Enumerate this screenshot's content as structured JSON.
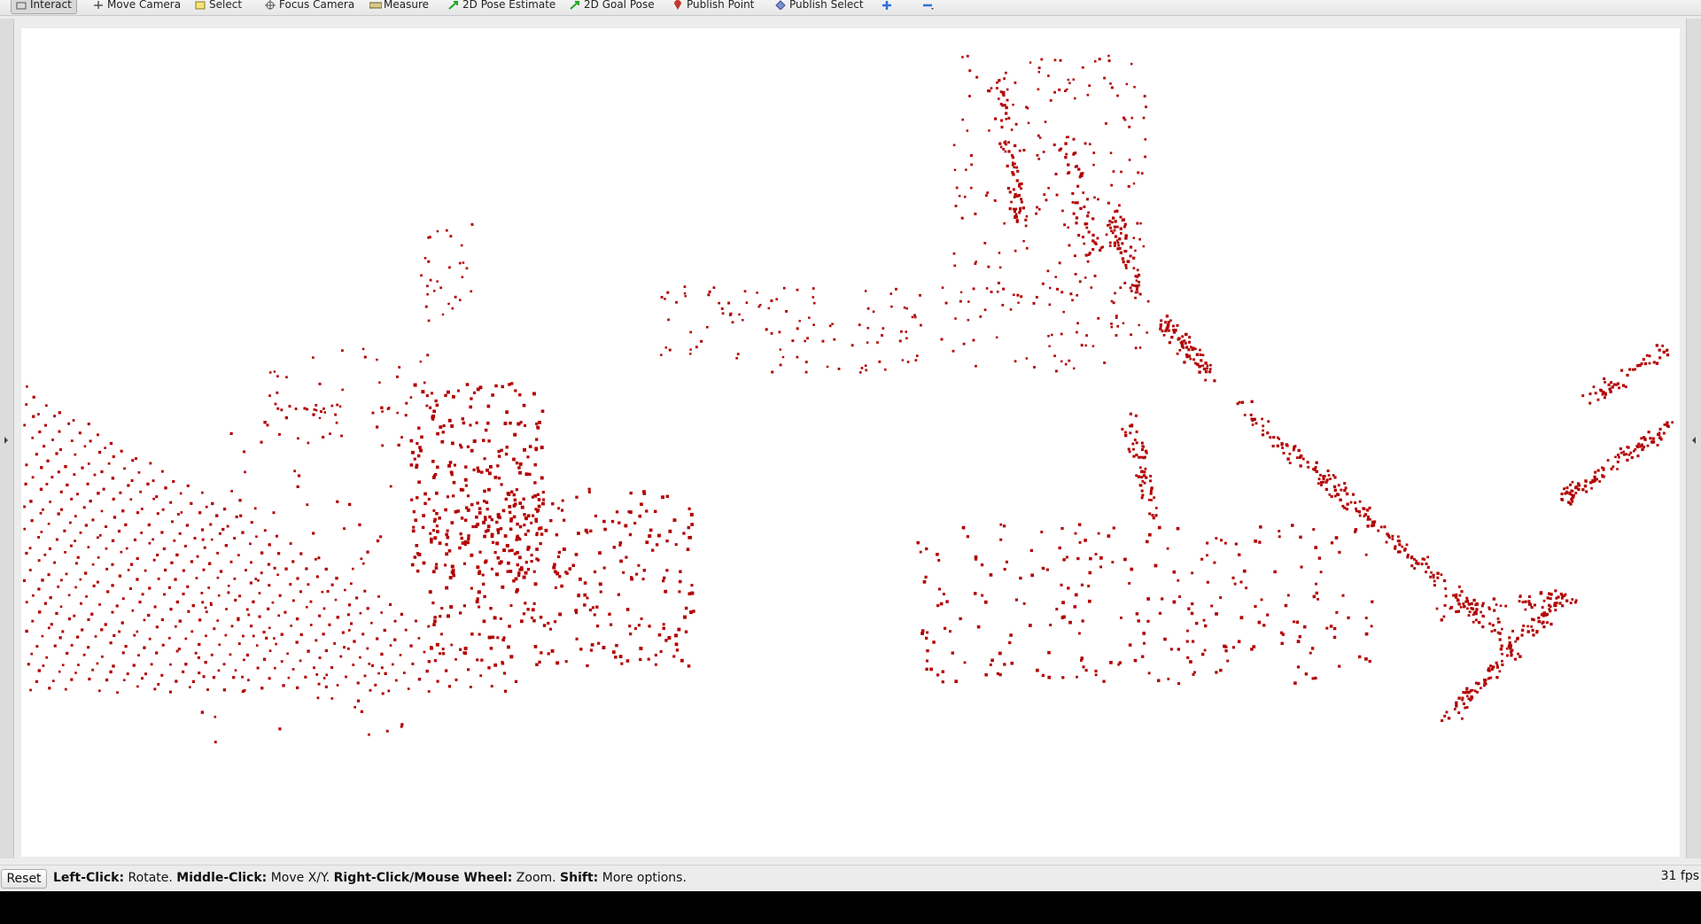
{
  "toolbar": {
    "tools": [
      {
        "id": "interact",
        "label": "Interact",
        "icon": "cursor-icon",
        "active": true
      },
      {
        "id": "move-camera",
        "label": "Move Camera",
        "icon": "move-camera-icon"
      },
      {
        "id": "select",
        "label": "Select",
        "icon": "select-icon"
      },
      {
        "id": "focus-camera",
        "label": "Focus Camera",
        "icon": "focus-camera-icon"
      },
      {
        "id": "measure",
        "label": "Measure",
        "icon": "measure-icon"
      },
      {
        "id": "pose-estimate",
        "label": "2D Pose Estimate",
        "icon": "green-arrow-icon"
      },
      {
        "id": "goal-pose",
        "label": "2D Goal Pose",
        "icon": "green-arrow-icon"
      },
      {
        "id": "publish-point",
        "label": "Publish Point",
        "icon": "map-pin-icon"
      },
      {
        "id": "publish-select",
        "label": "Publish Select",
        "icon": "select-box-icon"
      }
    ],
    "add_icon": "plus-icon",
    "remove_icon": "minus-icon"
  },
  "viewport": {
    "background": "#ffffff",
    "point_color": "#b30000"
  },
  "statusbar": {
    "reset_label": "Reset",
    "help": {
      "left_click_key": "Left-Click:",
      "left_click_action": "Rotate.",
      "middle_click_key": "Middle-Click:",
      "middle_click_action": "Move X/Y.",
      "right_click_key": "Right-Click/Mouse Wheel:",
      "right_click_action": "Zoom.",
      "shift_key": "Shift:",
      "shift_action": "More options."
    },
    "fps": "31 fps"
  }
}
